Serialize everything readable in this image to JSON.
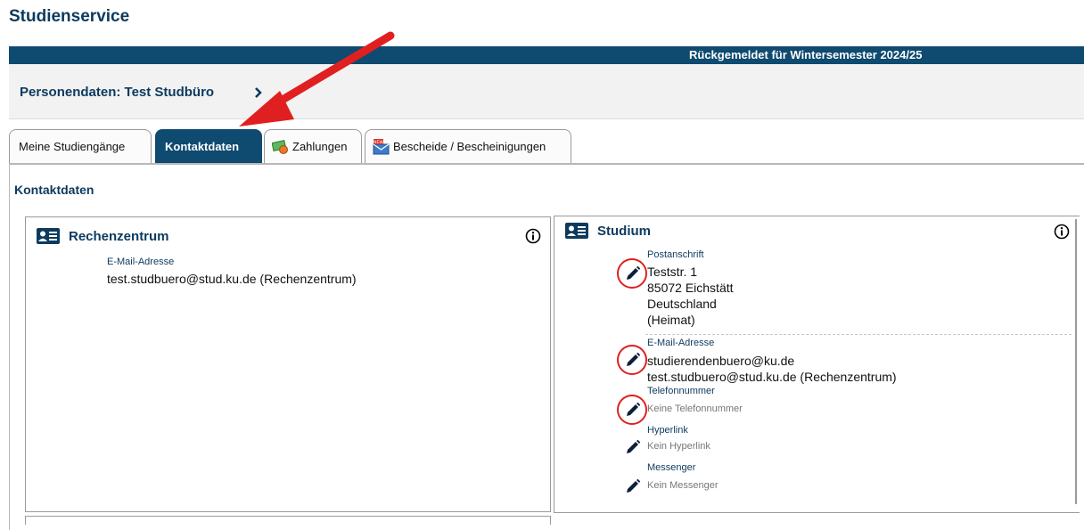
{
  "page": {
    "title": "Studienservice",
    "status": "Rückgemeldet für Wintersemester 2024/25",
    "person_label": "Personendaten: Test Studbüro"
  },
  "tabs": [
    {
      "label": "Meine Studiengänge",
      "icon": null,
      "active": false
    },
    {
      "label": "Kontaktdaten",
      "icon": null,
      "active": true
    },
    {
      "label": "Zahlungen",
      "icon": "money-icon",
      "active": false
    },
    {
      "label": "Bescheide / Bescheinigungen",
      "icon": "new-mail-icon",
      "active": false
    }
  ],
  "section": {
    "title": "Kontaktdaten"
  },
  "rechenzentrum": {
    "title": "Rechenzentrum",
    "email_label": "E-Mail-Adresse",
    "email_value": "test.studbuero@stud.ku.de (Rechenzentrum)"
  },
  "studium": {
    "title": "Studium",
    "postanschrift_label": "Postanschrift",
    "address_lines": [
      "Teststr. 1",
      "85072 Eichstätt",
      "Deutschland",
      "(Heimat)"
    ],
    "email_label": "E-Mail-Adresse",
    "email_lines": [
      "studierendenbuero@ku.de",
      "test.studbuero@stud.ku.de (Rechenzentrum)"
    ],
    "phone_label": "Telefonnummer",
    "phone_value": "Keine Telefonnummer",
    "hyperlink_label": "Hyperlink",
    "hyperlink_value": "Kein Hyperlink",
    "messenger_label": "Messenger",
    "messenger_value": "Kein Messenger"
  },
  "colors": {
    "brand": "#0f4a70",
    "heading": "#0c3a5e",
    "annotation": "#e02020"
  }
}
